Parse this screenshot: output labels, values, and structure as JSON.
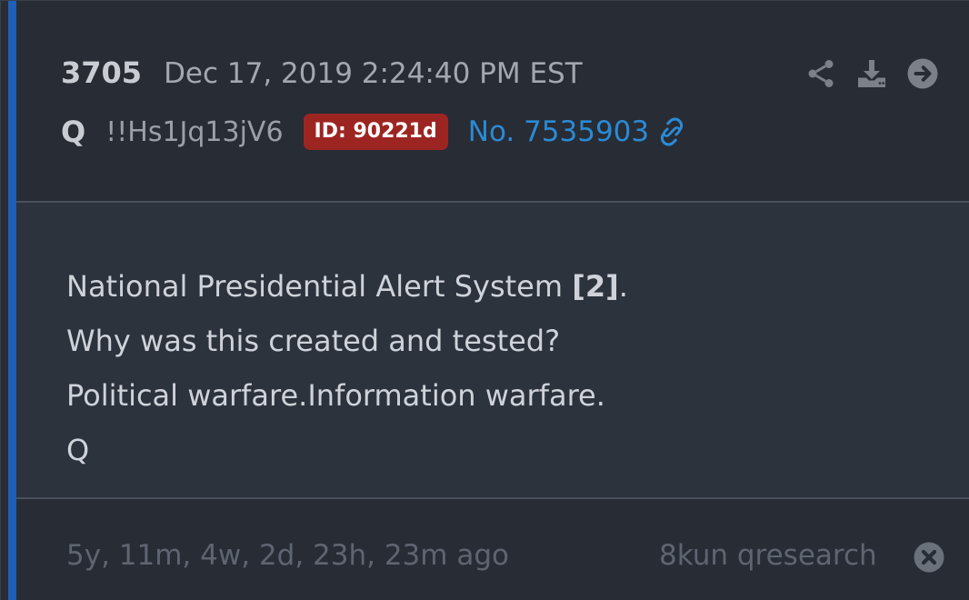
{
  "post": {
    "number": "3705",
    "timestamp": "Dec 17, 2019 2:24:40 PM EST",
    "author": "Q",
    "tripcode": "!!Hs1Jq13jV6",
    "id_badge": "ID: 90221d",
    "post_link": "No. 7535903"
  },
  "actions": {
    "icons": [
      "share-icon",
      "download-icon",
      "arrow-right-circle-icon"
    ]
  },
  "message": {
    "line1_text": "National Presidential Alert System ",
    "line1_ref": "[2]",
    "line1_end": ".",
    "line2": "Why was this created and tested?",
    "line3": "Political warfare.Information warfare.",
    "line4": "Q"
  },
  "footer": {
    "age": "5y, 11m, 4w, 2d, 23h, 23m ago",
    "source": "8kun qresearch"
  },
  "colors": {
    "accent": "#1f5fb8",
    "badge": "#9c2522",
    "link": "#2b8ad4",
    "background": "#272c35",
    "body_background": "#2d333d"
  }
}
